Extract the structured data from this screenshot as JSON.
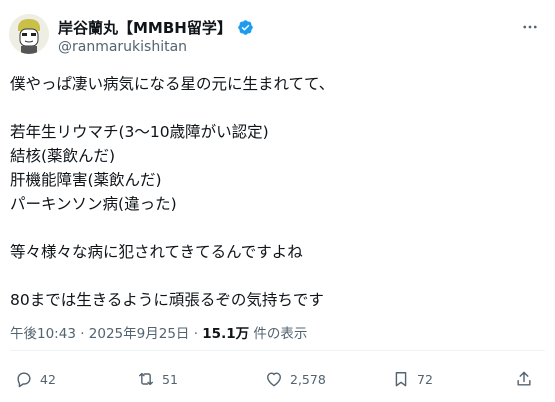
{
  "author": {
    "display_name": "岸谷蘭丸【MMBH留学】",
    "handle": "@ranmarukishitan",
    "verified_color": "#1d9bf0"
  },
  "tweet": {
    "lines": [
      "僕やっぱ凄い病気になる星の元に生まれてて、",
      "",
      "若年生リウマチ(3〜10歳障がい認定)",
      "結核(薬飲んだ)",
      "肝機能障害(薬飲んだ)",
      "パーキンソン病(違った)",
      "",
      "等々様々な病に犯されてきてるんですよね",
      "",
      "80までは生きるように頑張るぞの気持ちです"
    ]
  },
  "meta": {
    "time": "午後10:43",
    "separator": " · ",
    "date": "2025年9月25日",
    "views_count": "15.1万",
    "views_label": " 件の表示"
  },
  "actions": {
    "reply_count": "42",
    "retweet_count": "51",
    "like_count": "2,578",
    "bookmark_count": "72"
  },
  "icons": {
    "more": "more-dots-icon",
    "reply": "reply-bubble-icon",
    "retweet": "retweet-icon",
    "like": "heart-icon",
    "bookmark": "bookmark-icon",
    "share": "share-upload-icon"
  },
  "colors": {
    "text": "#0f1419",
    "secondary": "#536471",
    "accent": "#1d9bf0",
    "divider": "#eff3f4"
  }
}
